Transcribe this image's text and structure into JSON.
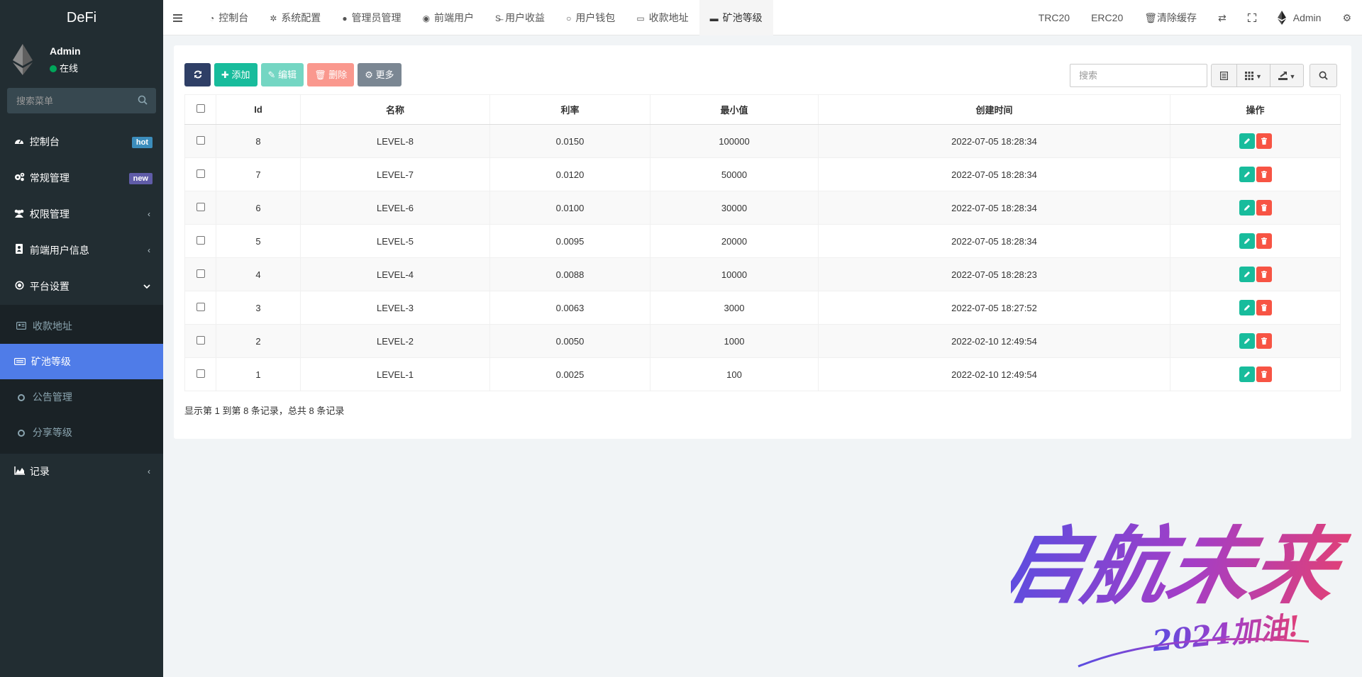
{
  "sidebar": {
    "logo": "DeFi",
    "user": {
      "name": "Admin",
      "status": "在线"
    },
    "search_placeholder": "搜索菜单",
    "menu": [
      {
        "label": "控制台",
        "icon": "dashboard-icon",
        "badge": "hot"
      },
      {
        "label": "常规管理",
        "icon": "cogs-icon",
        "badge": "new"
      },
      {
        "label": "权限管理",
        "icon": "users-icon"
      },
      {
        "label": "前端用户信息",
        "icon": "address-book-icon"
      },
      {
        "label": "平台设置",
        "icon": "dot-circle-icon",
        "expanded": true
      }
    ],
    "submenu": [
      {
        "label": "收款地址",
        "icon": "id-card-icon"
      },
      {
        "label": "矿池等级",
        "icon": "keyboard-icon",
        "active": true
      },
      {
        "label": "公告管理",
        "icon": "circle-o-icon"
      },
      {
        "label": "分享等级",
        "icon": "circle-o-icon"
      }
    ],
    "records": {
      "label": "记录",
      "icon": "area-chart-icon"
    }
  },
  "header": {
    "tabs": [
      {
        "label": "控制台",
        "icon": "dashboard-icon"
      },
      {
        "label": "系统配置",
        "icon": "gear-icon"
      },
      {
        "label": "管理员管理",
        "icon": "user-icon"
      },
      {
        "label": "前端用户",
        "icon": "user-circle-icon"
      },
      {
        "label": "用户收益",
        "icon": "strikethrough-icon"
      },
      {
        "label": "用户钱包",
        "icon": "circle-o-icon"
      },
      {
        "label": "收款地址",
        "icon": "id-card-icon"
      },
      {
        "label": "矿池等级",
        "icon": "keyboard-icon",
        "active": true
      }
    ],
    "right": {
      "trc20": "TRC20",
      "erc20": "ERC20",
      "clear_cache": "清除缓存",
      "admin": "Admin"
    }
  },
  "toolbar": {
    "add": "添加",
    "edit": "编辑",
    "delete": "删除",
    "more": "更多",
    "search_placeholder": "搜索"
  },
  "table": {
    "columns": [
      "Id",
      "名称",
      "利率",
      "最小值",
      "创建时间",
      "操作"
    ],
    "rows": [
      {
        "id": "8",
        "name": "LEVEL-8",
        "rate": "0.0150",
        "min": "100000",
        "created": "2022-07-05 18:28:34"
      },
      {
        "id": "7",
        "name": "LEVEL-7",
        "rate": "0.0120",
        "min": "50000",
        "created": "2022-07-05 18:28:34"
      },
      {
        "id": "6",
        "name": "LEVEL-6",
        "rate": "0.0100",
        "min": "30000",
        "created": "2022-07-05 18:28:34"
      },
      {
        "id": "5",
        "name": "LEVEL-5",
        "rate": "0.0095",
        "min": "20000",
        "created": "2022-07-05 18:28:34"
      },
      {
        "id": "4",
        "name": "LEVEL-4",
        "rate": "0.0088",
        "min": "10000",
        "created": "2022-07-05 18:28:23"
      },
      {
        "id": "3",
        "name": "LEVEL-3",
        "rate": "0.0063",
        "min": "3000",
        "created": "2022-07-05 18:27:52"
      },
      {
        "id": "2",
        "name": "LEVEL-2",
        "rate": "0.0050",
        "min": "1000",
        "created": "2022-02-10 12:49:54"
      },
      {
        "id": "1",
        "name": "LEVEL-1",
        "rate": "0.0025",
        "min": "100",
        "created": "2022-02-10 12:49:54"
      }
    ]
  },
  "pager_info": "显示第 1 到第 8 条记录，总共 8 条记录",
  "watermark": {
    "main": "启航未来",
    "sub": "2024加油!"
  },
  "colors": {
    "sidebar_bg": "#222d32",
    "active_menu": "#4f7ce8",
    "success": "#18bc9c",
    "danger": "#f75444"
  }
}
